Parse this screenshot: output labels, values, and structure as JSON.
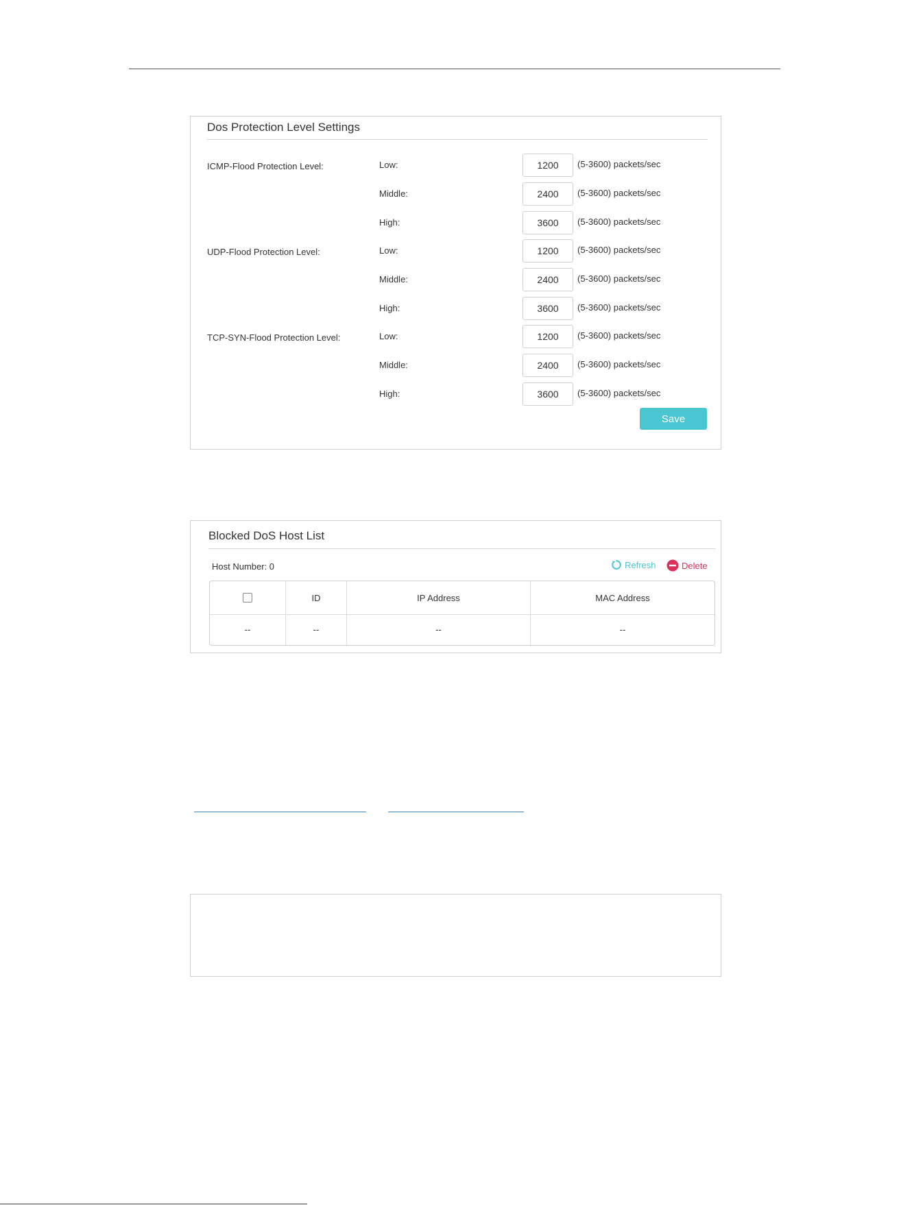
{
  "dos_settings": {
    "title": "Dos Protection Level Settings",
    "groups": [
      {
        "label": "ICMP-Flood Protection Level:",
        "levels": [
          {
            "label": "Low:",
            "value": "1200",
            "unit": "(5-3600) packets/sec"
          },
          {
            "label": "Middle:",
            "value": "2400",
            "unit": "(5-3600) packets/sec"
          },
          {
            "label": "High:",
            "value": "3600",
            "unit": "(5-3600) packets/sec"
          }
        ]
      },
      {
        "label": "UDP-Flood Protection Level:",
        "levels": [
          {
            "label": "Low:",
            "value": "1200",
            "unit": "(5-3600) packets/sec"
          },
          {
            "label": "Middle:",
            "value": "2400",
            "unit": "(5-3600) packets/sec"
          },
          {
            "label": "High:",
            "value": "3600",
            "unit": "(5-3600) packets/sec"
          }
        ]
      },
      {
        "label": "TCP-SYN-Flood Protection Level:",
        "levels": [
          {
            "label": "Low:",
            "value": "1200",
            "unit": "(5-3600) packets/sec"
          },
          {
            "label": "Middle:",
            "value": "2400",
            "unit": "(5-3600) packets/sec"
          },
          {
            "label": "High:",
            "value": "3600",
            "unit": "(5-3600) packets/sec"
          }
        ]
      }
    ],
    "save_label": "Save",
    "accent_color": "#4ac6d2"
  },
  "host_list": {
    "title": "Blocked DoS Host List",
    "host_number_label": "Host Number: 0",
    "refresh_label": "Refresh",
    "delete_label": "Delete",
    "refresh_icon": "refresh-icon",
    "delete_icon": "minus-circle-icon",
    "delete_color": "#d9325d",
    "columns": [
      "",
      "ID",
      "IP Address",
      "MAC Address"
    ],
    "rows": [
      [
        "--",
        "--",
        "--",
        "--"
      ]
    ]
  }
}
